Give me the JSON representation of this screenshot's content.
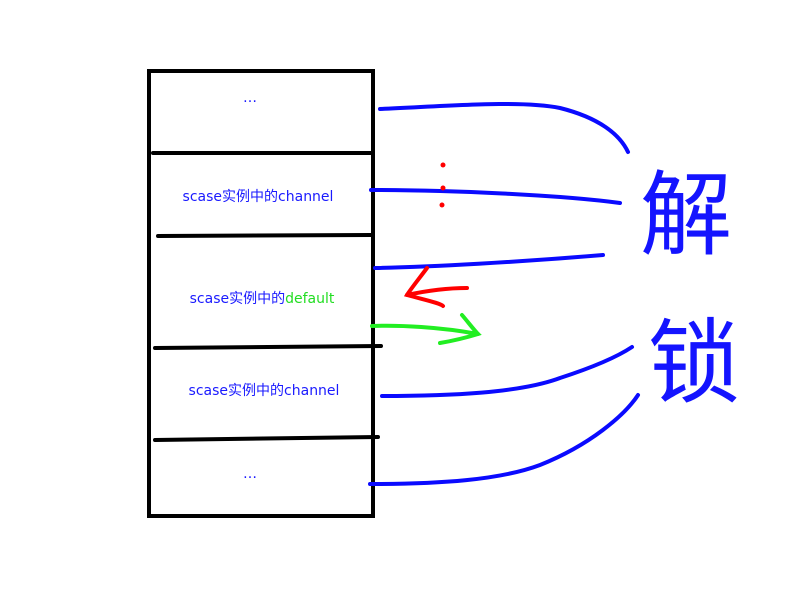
{
  "slots": [
    {
      "text": "…"
    },
    {
      "prefix": "scase实例中的",
      "suffix": "channel"
    },
    {
      "prefix": "scase实例中的",
      "suffix": "default"
    },
    {
      "prefix": "scase实例中的",
      "suffix": "channel"
    },
    {
      "text": "…"
    }
  ],
  "unlock_label": {
    "char1": "解",
    "char2": "锁"
  },
  "colors": {
    "lines": "#0a0aff",
    "box": "#000000",
    "red_arrow": "#ff0000",
    "green_arrow": "#22ee22"
  }
}
